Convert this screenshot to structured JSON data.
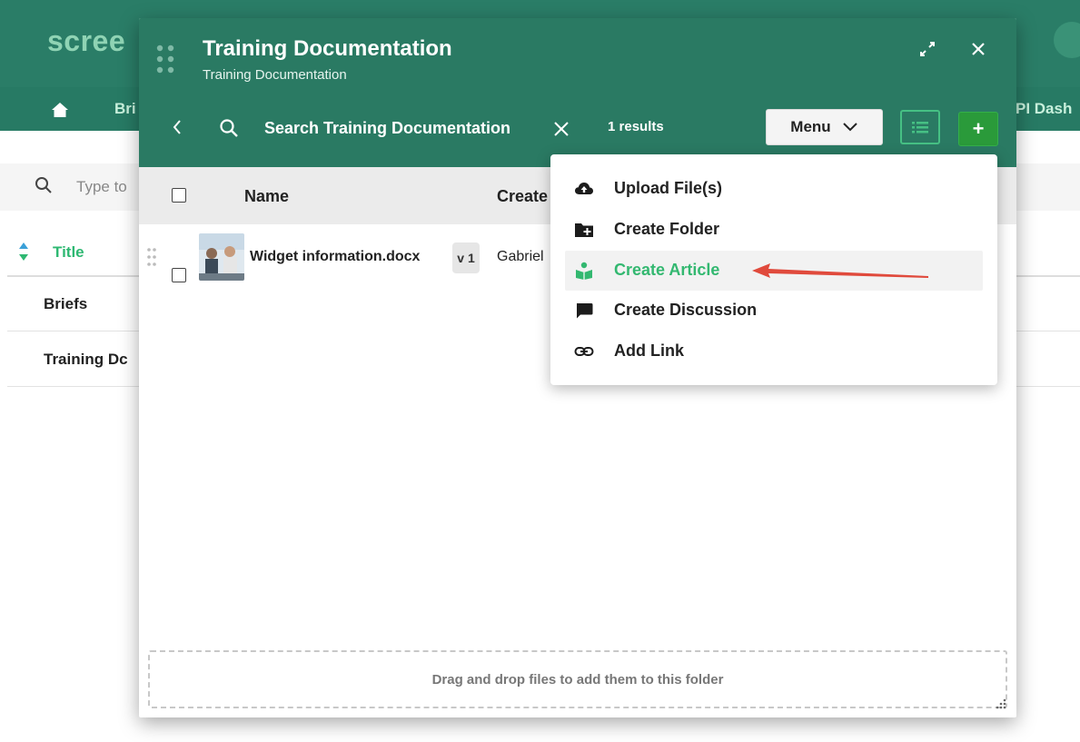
{
  "app": {
    "logo": "scree",
    "nav": {
      "items": [
        "Bri",
        "PI Dash"
      ]
    },
    "search_placeholder": "Type to",
    "table": {
      "title_col": "Title",
      "rows": [
        "Briefs",
        "Training Dc"
      ]
    }
  },
  "modal": {
    "title": "Training Documentation",
    "subtitle": "Training Documentation",
    "search": {
      "placeholder": "Search Training Documentation"
    },
    "results_count": "1 results",
    "menu_label": "Menu",
    "add_label": "+",
    "columns": {
      "name": "Name",
      "created": "Create"
    },
    "files": [
      {
        "name": "Widget information.docx",
        "version": "v 1",
        "created_by": "Gabriel"
      }
    ],
    "drop_zone": "Drag and drop files to add them to this folder"
  },
  "dropdown": {
    "items": [
      {
        "label": "Upload File(s)",
        "icon": "cloud-upload-icon"
      },
      {
        "label": "Create Folder",
        "icon": "folder-plus-icon"
      },
      {
        "label": "Create Article",
        "icon": "reading-book-icon",
        "highlighted": true
      },
      {
        "label": "Create Discussion",
        "icon": "chat-bubble-icon"
      },
      {
        "label": "Add Link",
        "icon": "link-icon"
      }
    ]
  },
  "colors": {
    "header_green": "#2a7a63",
    "accent_green": "#33b870",
    "add_button_green": "#2a9a3a",
    "annotation_red": "#e04a3c"
  }
}
